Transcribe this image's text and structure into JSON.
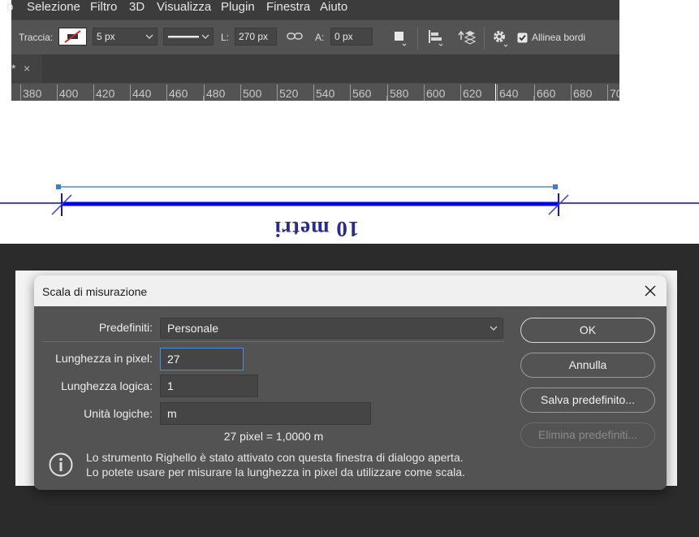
{
  "menubar": {
    "items": [
      "o",
      "Selezione",
      "Filtro",
      "3D",
      "Visualizza",
      "Plugin",
      "Finestra",
      "Aiuto"
    ]
  },
  "options_bar": {
    "stroke_label": "Traccia:",
    "stroke_width": "5 px",
    "width_label": "L:",
    "width_value": "270 px",
    "height_label": "A:",
    "height_value": "0 px",
    "align_edges_label": "Allinea bordi",
    "align_edges_checked": true
  },
  "document_tab": {
    "title_fragment": "*",
    "close_glyph": "×"
  },
  "ruler": {
    "labels": [
      "380",
      "400",
      "420",
      "440",
      "460",
      "480",
      "500",
      "520",
      "540",
      "560",
      "580",
      "600",
      "620",
      "640",
      "660",
      "680",
      "70"
    ]
  },
  "canvas": {
    "map_label": "10 metri",
    "line_color": "#0000ee",
    "guide_color": "#4a90d9"
  },
  "dialog": {
    "title": "Scala di misurazione",
    "presets_label": "Predefiniti:",
    "presets_value": "Personale",
    "pixel_length_label": "Lunghezza in pixel:",
    "pixel_length_value": "27",
    "logical_length_label": "Lunghezza logica:",
    "logical_length_value": "1",
    "logical_units_label": "Unità logiche:",
    "logical_units_value": "m",
    "equation": "27 pixel = 1,0000 m",
    "info_line1": "Lo strumento Righello è stato attivato con questa finestra di dialogo aperta.",
    "info_line2": "Lo potete usare per misurare la lunghezza in pixel da utilizzare come scala.",
    "ok_label": "OK",
    "cancel_label": "Annulla",
    "save_preset_label": "Salva predefinito...",
    "delete_preset_label": "Elimina predefiniti..."
  }
}
